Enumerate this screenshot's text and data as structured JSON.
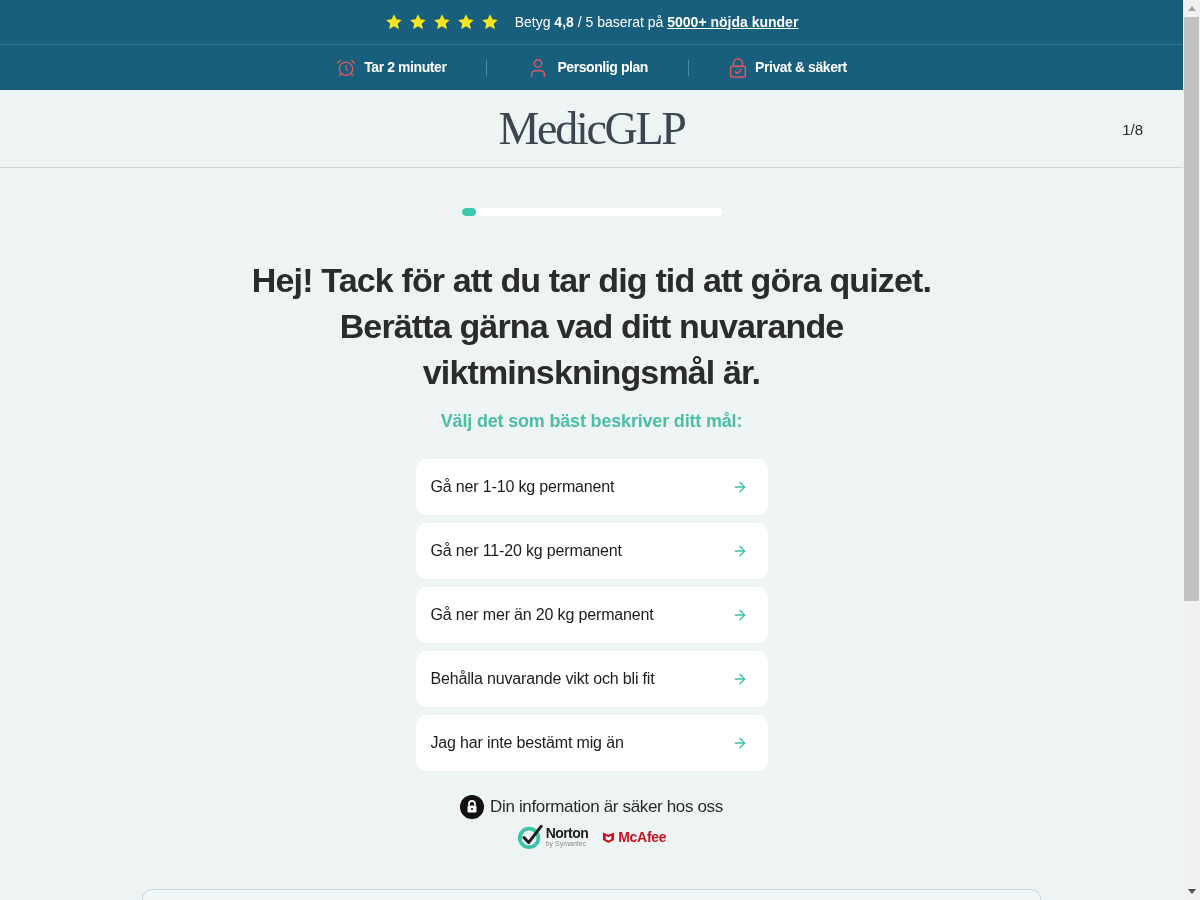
{
  "rating_bar": {
    "stars": 5,
    "text": "Betyg **4,8** / 5 baserat på",
    "link": "5000+ nöjda kunder"
  },
  "features": [
    {
      "kind": "clock",
      "label": "Tar 2 minuter"
    },
    {
      "kind": "person",
      "label": "Personlig plan"
    },
    {
      "kind": "lock",
      "label": "Privat & säkert"
    }
  ],
  "header": {
    "logo": "MedicGLP",
    "step": "1/8"
  },
  "progress": {
    "level": 0.055
  },
  "question": {
    "title": "Hej! Tack för att du tar dig tid att göra quizet. Berätta gärna vad ditt nuvarande viktminskningsmål är.",
    "subtitle": "Välj det som bäst beskriver ditt mål:"
  },
  "options": [
    {
      "label": "Gå ner 1-10 kg permanent"
    },
    {
      "label": "Gå ner 11-20 kg permanent"
    },
    {
      "label": "Gå ner mer än 20 kg permanent"
    },
    {
      "label": "Behålla nuvarande vikt och bli fit"
    },
    {
      "label": "Jag har inte bestämt mig än"
    }
  ],
  "security": {
    "text": "Din information är säker hos oss",
    "badges": [
      {
        "kind": "norton",
        "name": "Norton",
        "tagline": "by Symantec"
      },
      {
        "kind": "mcafee",
        "name": "McAfee"
      }
    ]
  }
}
